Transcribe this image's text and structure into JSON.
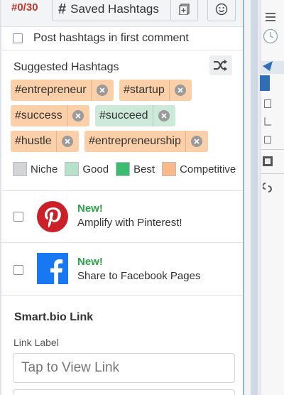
{
  "topbar": {
    "count": "#0/30",
    "saved_hashtags_label": "Saved Hashtags",
    "hash_glyph": "#"
  },
  "first_comment": {
    "label": "Post hashtags in first comment",
    "checked": false
  },
  "suggested": {
    "title": "Suggested Hashtags",
    "tags": [
      {
        "text": "#entrepreneur",
        "type": "Competitive"
      },
      {
        "text": "#startup",
        "type": "Competitive"
      },
      {
        "text": "#success",
        "type": "Competitive"
      },
      {
        "text": "#succeed",
        "type": "Good"
      },
      {
        "text": "#hustle",
        "type": "Competitive"
      },
      {
        "text": "#entrepreneurship",
        "type": "Competitive"
      }
    ]
  },
  "legend": [
    {
      "label": "Niche",
      "color": "#d3d4d6"
    },
    {
      "label": "Good",
      "color": "#b5e2c9"
    },
    {
      "label": "Best",
      "color": "#3dbb70"
    },
    {
      "label": "Competitive",
      "color": "#fbb98a"
    }
  ],
  "promos": [
    {
      "new": "New!",
      "text": "Amplify with Pinterest!",
      "icon": "pinterest-icon",
      "checked": false
    },
    {
      "new": "New!",
      "text": "Share to Facebook Pages",
      "icon": "facebook-icon",
      "checked": false
    }
  ],
  "smartbio": {
    "title": "Smart.bio Link",
    "link_label": "Link Label",
    "placeholder": "Tap to View Link"
  },
  "colors": {
    "count_red": "#c0392b",
    "new_green": "#2ea24a",
    "pinterest_red": "#cb2027",
    "facebook_blue": "#1877f2"
  }
}
